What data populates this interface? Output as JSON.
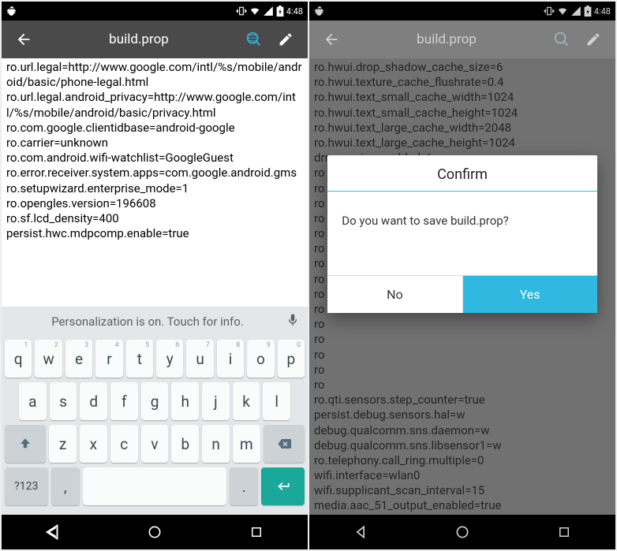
{
  "status": {
    "time": "4:48"
  },
  "appbar": {
    "title": "build.prop"
  },
  "left": {
    "lines": [
      "ro.url.legal=http://www.google.com/intl/%s/mobile/android/basic/phone-legal.html",
      "ro.url.legal.android_privacy=http://www.google.com/intl/%s/mobile/android/basic/privacy.html",
      "ro.com.google.clientidbase=android-google",
      "ro.carrier=unknown",
      "ro.com.android.wifi-watchlist=GoogleGuest",
      "ro.error.receiver.system.apps=com.google.android.gms",
      "ro.setupwizard.enterprise_mode=1",
      "ro.opengles.version=196608",
      "ro.sf.lcd_density=400",
      "persist.hwc.mdpcomp.enable=true"
    ],
    "suggestion": "Personalization is on. Touch for info.",
    "keys": {
      "r1": [
        "q",
        "w",
        "e",
        "r",
        "t",
        "y",
        "u",
        "i",
        "o",
        "p"
      ],
      "r1sup": [
        "1",
        "2",
        "3",
        "4",
        "5",
        "6",
        "7",
        "8",
        "9",
        "0"
      ],
      "r2": [
        "a",
        "s",
        "d",
        "f",
        "g",
        "h",
        "j",
        "k",
        "l"
      ],
      "r3": [
        "z",
        "x",
        "c",
        "v",
        "b",
        "n",
        "m"
      ],
      "sym": "?123",
      "comma": ",",
      "period": "."
    }
  },
  "right": {
    "lines": [
      "ro.hwui.drop_shadow_cache_size=6",
      "ro.hwui.texture_cache_flushrate=0.4",
      "ro.hwui.text_small_cache_width=1024",
      "ro.hwui.text_small_cache_height=1024",
      "ro.hwui.text_large_cache_width=2048",
      "ro.hwui.text_large_cache_height=1024",
      "drm.service.enabled=true",
      "ro",
      "ro",
      "ro",
      "ro",
      "ro",
      "ro",
      "ro",
      "ro",
      "ro",
      "ro",
      "ro",
      "ro",
      "ro",
      "ro",
      "ro",
      "ro.qti.sensors.step_counter=true",
      "persist.debug.sensors.hal=w",
      "debug.qualcomm.sns.daemon=w",
      "debug.qualcomm.sns.libsensor1=w",
      "ro.telephony.call_ring.multiple=0",
      "wifi.interface=wlan0",
      "wifi.supplicant_scan_interval=15",
      "media.aac_51_output_enabled=true"
    ],
    "dialog": {
      "title": "Confirm",
      "message": "Do you want to save build.prop?",
      "no": "No",
      "yes": "Yes"
    }
  }
}
